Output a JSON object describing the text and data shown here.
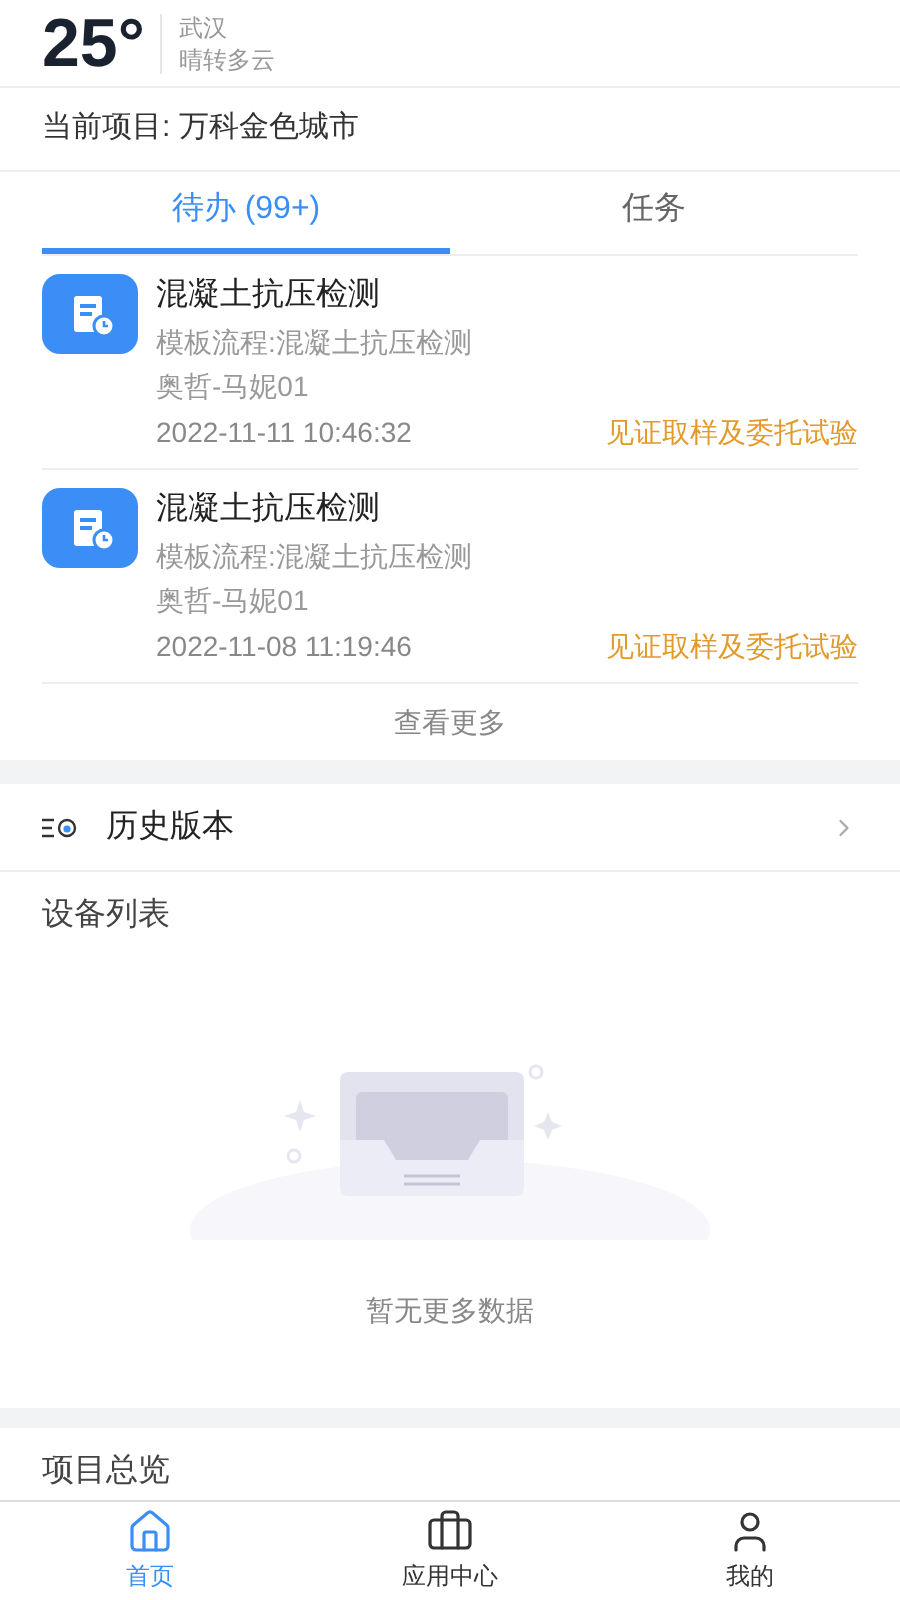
{
  "weather": {
    "temperature": "25°",
    "city": "武汉",
    "condition": "晴转多云"
  },
  "project": {
    "label": "当前项目: 万科金色城市"
  },
  "tabs": [
    {
      "label": "待办 (99+)",
      "selected": true
    },
    {
      "label": "任务",
      "selected": false
    }
  ],
  "tasks": [
    {
      "title": "混凝土抗压检测",
      "flow": "模板流程:混凝土抗压检测",
      "site": "奥哲-马妮01",
      "time": "2022-11-11 10:46:32",
      "stage": "见证取样及委托试验"
    },
    {
      "title": "混凝土抗压检测",
      "flow": "模板流程:混凝土抗压检测",
      "site": "奥哲-马妮01",
      "time": "2022-11-08 11:19:46",
      "stage": "见证取样及委托试验"
    }
  ],
  "more": "查看更多",
  "history": {
    "label": "历史版本"
  },
  "devices": {
    "title": "设备列表",
    "empty": "暂无更多数据"
  },
  "overview": {
    "title": "项目总览"
  },
  "nav": [
    {
      "label": "首页",
      "selected": true
    },
    {
      "label": "应用中心",
      "selected": false
    },
    {
      "label": "我的",
      "selected": false
    }
  ]
}
